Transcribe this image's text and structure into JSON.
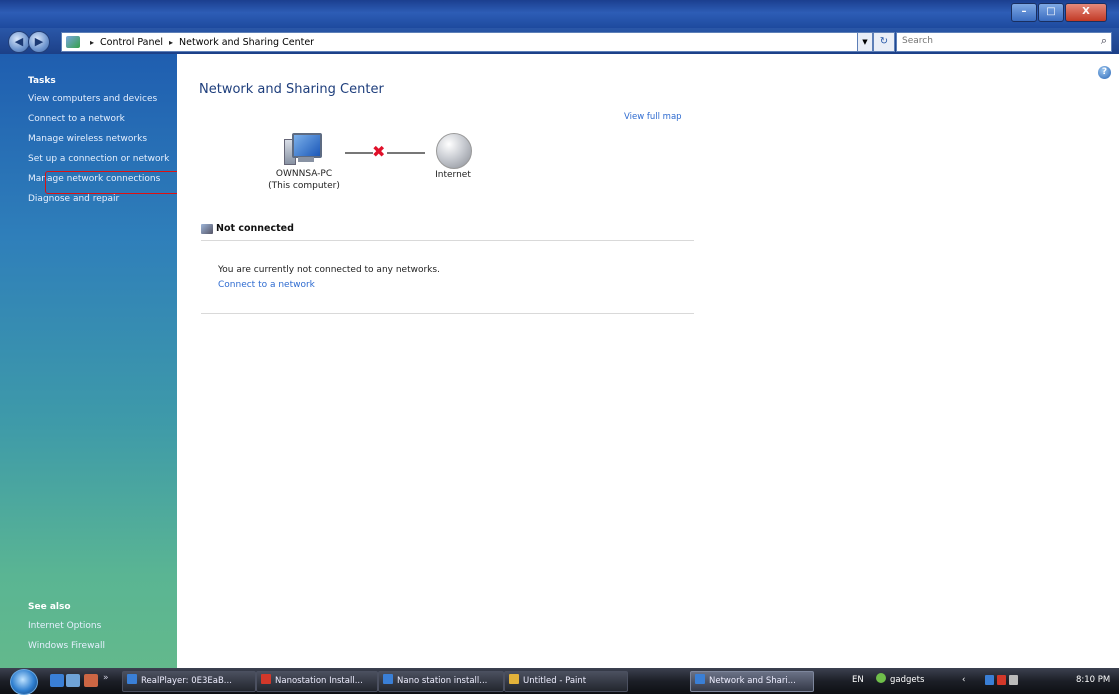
{
  "window": {
    "min_label": "–",
    "max_label": "□",
    "close_label": "X"
  },
  "address": {
    "crumbs": [
      "Control Panel",
      "Network and Sharing Center"
    ],
    "separator": "▸",
    "search_placeholder": "Search"
  },
  "sidebar": {
    "tasks_heading": "Tasks",
    "tasks": [
      "View computers and devices",
      "Connect to a network",
      "Manage wireless networks",
      "Set up a connection or network",
      "Manage network connections",
      "Diagnose and repair"
    ],
    "see_also_heading": "See also",
    "see_also": [
      "Internet Options",
      "Windows Firewall"
    ]
  },
  "main": {
    "title": "Network and Sharing Center",
    "view_full_map": "View full map",
    "computer_name": "OWNNSA-PC",
    "computer_sub": "(This computer)",
    "internet_label": "Internet",
    "status": "Not connected",
    "message": "You are currently not connected to any networks.",
    "connect_link": "Connect to a network",
    "help": "?"
  },
  "taskbar": {
    "tasks": [
      {
        "label": "RealPlayer: 0E3EaB...",
        "color": "#3a7fd6"
      },
      {
        "label": "Nanostation Install...",
        "color": "#d2382a"
      },
      {
        "label": "Nano station install...",
        "color": "#3a7fd6"
      },
      {
        "label": "Untitled - Paint",
        "color": "#e2b23a"
      },
      {
        "label": "Network and Shari...",
        "color": "#3a7fd6",
        "active": true
      }
    ],
    "lang": "EN",
    "gadget": "gadgets",
    "clock": "8:10 PM"
  },
  "colors": {
    "accent": "#2e6bd0",
    "error_x": "#e0102a",
    "highlight": "#dd1111"
  }
}
